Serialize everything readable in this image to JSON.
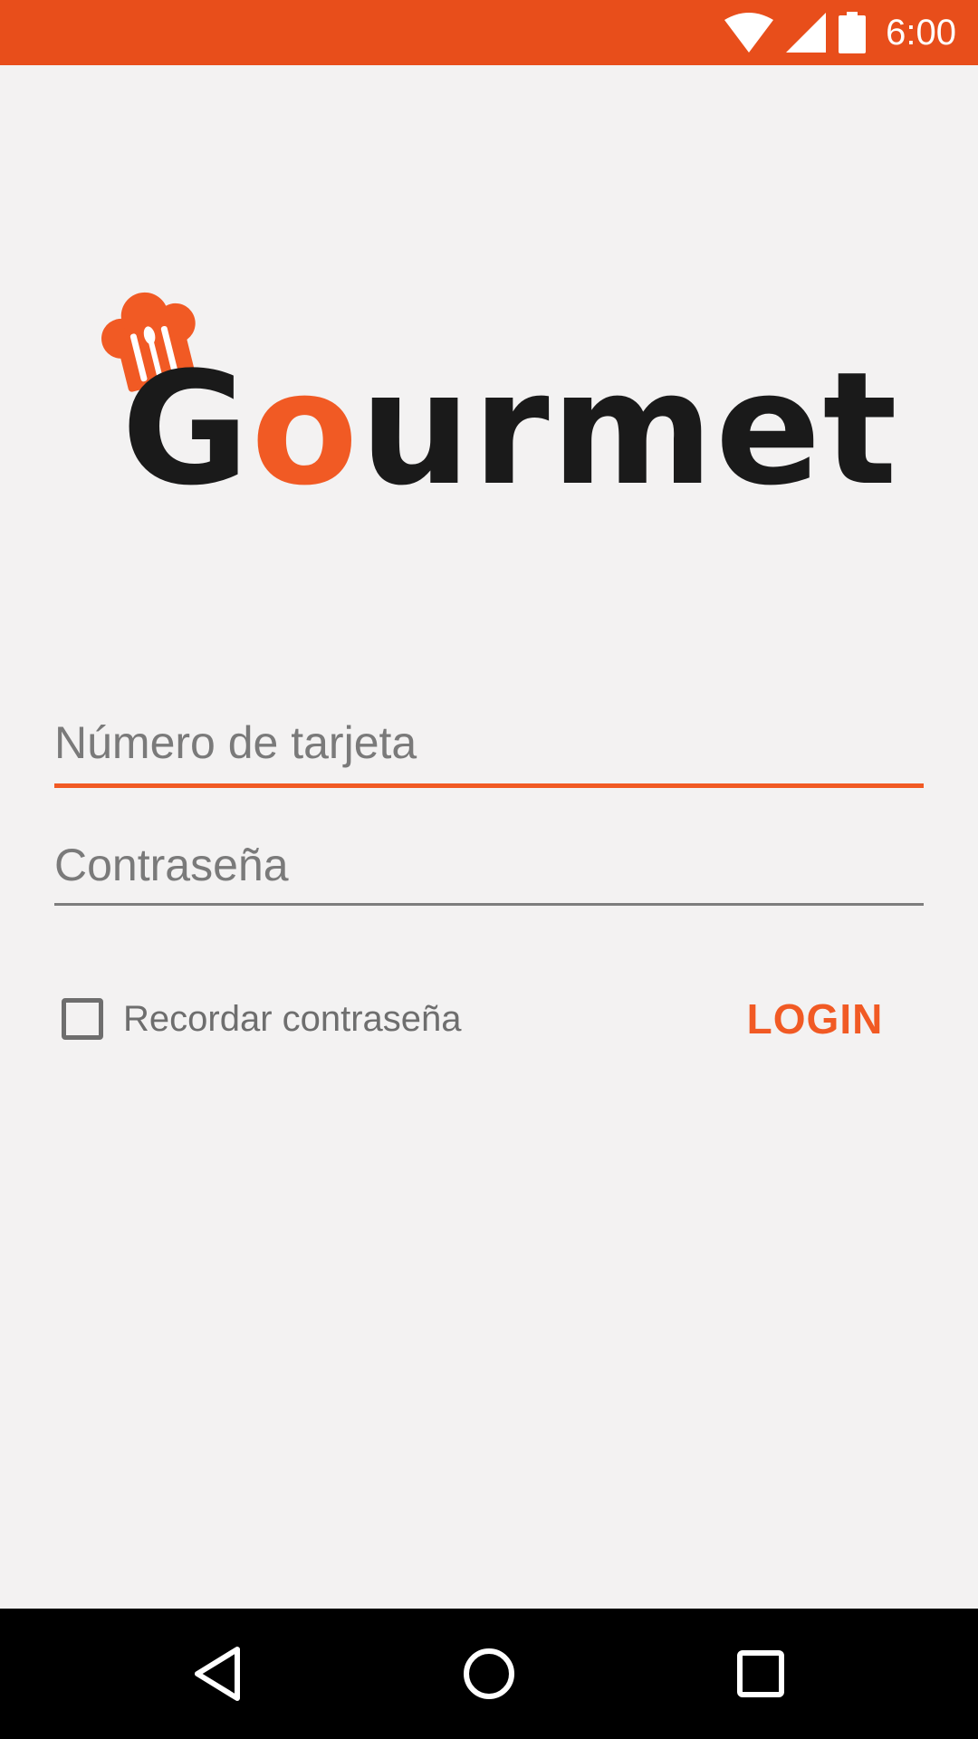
{
  "status_bar": {
    "time": "6:00",
    "icons": [
      "wifi-icon",
      "signal-icon",
      "battery-icon"
    ],
    "color": "#e84e1b"
  },
  "logo": {
    "text_g": "G",
    "text_o": "o",
    "text_rest": "urmet",
    "icon": "chef-hat-icon",
    "accent_color": "#f15a24"
  },
  "form": {
    "card_number_placeholder": "Número de tarjeta",
    "password_placeholder": "Contraseña",
    "remember_label": "Recordar contraseña",
    "remember_checked": false,
    "login_label": "LOGIN"
  },
  "nav_bar": {
    "icons": [
      "back-icon",
      "home-icon",
      "recents-icon"
    ]
  }
}
